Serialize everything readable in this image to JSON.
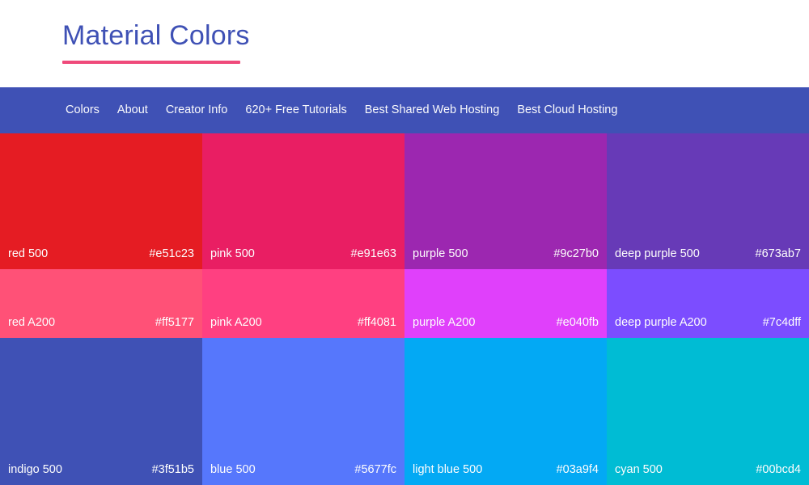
{
  "header": {
    "title": "Material Colors",
    "title_color": "#3f51b5",
    "underline_color": "#ef4a7b"
  },
  "nav": {
    "background": "#3f51b5",
    "text_color": "#ffffff",
    "items": [
      {
        "label": "Colors"
      },
      {
        "label": "About"
      },
      {
        "label": "Creator Info"
      },
      {
        "label": "620+ Free Tutorials"
      },
      {
        "label": "Best Shared Web Hosting"
      },
      {
        "label": "Best Cloud Hosting"
      }
    ]
  },
  "swatch_rows": [
    {
      "height_class": "tall",
      "swatches": [
        {
          "name": "red 500",
          "hex": "#e51c23"
        },
        {
          "name": "pink 500",
          "hex": "#e91e63"
        },
        {
          "name": "purple 500",
          "hex": "#9c27b0"
        },
        {
          "name": "deep purple 500",
          "hex": "#673ab7"
        }
      ]
    },
    {
      "height_class": "short",
      "swatches": [
        {
          "name": "red A200",
          "hex": "#ff5177"
        },
        {
          "name": "pink A200",
          "hex": "#ff4081"
        },
        {
          "name": "purple A200",
          "hex": "#e040fb"
        },
        {
          "name": "deep purple A200",
          "hex": "#7c4dff"
        }
      ]
    },
    {
      "height_class": "tall2",
      "swatches": [
        {
          "name": "indigo 500",
          "hex": "#3f51b5"
        },
        {
          "name": "blue 500",
          "hex": "#5677fc"
        },
        {
          "name": "light blue 500",
          "hex": "#03a9f4"
        },
        {
          "name": "cyan 500",
          "hex": "#00bcd4"
        }
      ]
    }
  ]
}
